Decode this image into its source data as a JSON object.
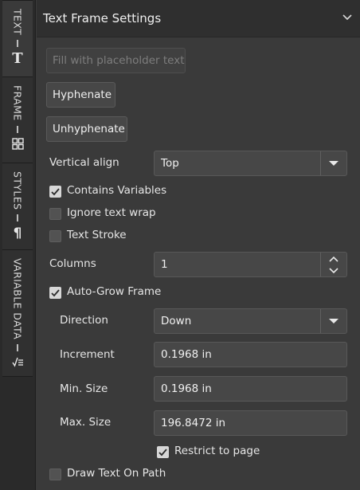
{
  "tabs": [
    {
      "label": "TEXT",
      "icon": "text-t-icon",
      "active": true
    },
    {
      "label": "FRAME",
      "icon": "frame-grid-icon",
      "active": false
    },
    {
      "label": "STYLES",
      "icon": "pilcrow-icon",
      "active": false
    },
    {
      "label": "VARIABLE DATA",
      "icon": "variable-data-icon",
      "active": false
    }
  ],
  "icons": {
    "text": "T",
    "pilcrow": "¶"
  },
  "panel": {
    "title": "Text Frame Settings",
    "fill_placeholder_label": "Fill with placeholder text",
    "hyphenate_label": "Hyphenate",
    "unhyphenate_label": "Unhyphenate",
    "vertical_align": {
      "label": "Vertical align",
      "value": "Top"
    },
    "contains_variables": {
      "label": "Contains Variables",
      "checked": true
    },
    "ignore_text_wrap": {
      "label": "Ignore text wrap",
      "checked": false
    },
    "text_stroke": {
      "label": "Text Stroke",
      "checked": false
    },
    "columns": {
      "label": "Columns",
      "value": "1"
    },
    "auto_grow": {
      "label": "Auto-Grow Frame",
      "checked": true
    },
    "direction": {
      "label": "Direction",
      "value": "Down"
    },
    "increment": {
      "label": "Increment",
      "value": "0.1968 in"
    },
    "min_size": {
      "label": "Min. Size",
      "value": "0.1968 in"
    },
    "max_size": {
      "label": "Max. Size",
      "value": "196.8472 in"
    },
    "restrict_to_page": {
      "label": "Restrict to page",
      "checked": true
    },
    "draw_text_on_path": {
      "label": "Draw Text On Path",
      "checked": false
    }
  }
}
